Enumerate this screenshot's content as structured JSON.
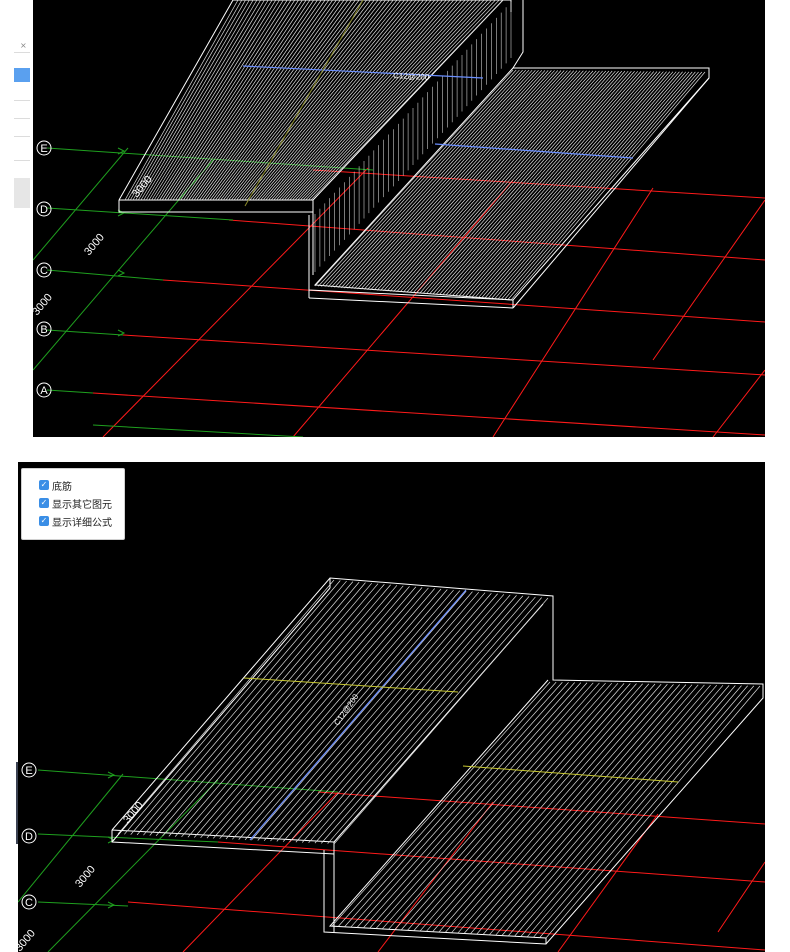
{
  "panel_top": {
    "axes": [
      "E",
      "D",
      "C",
      "B",
      "A"
    ],
    "dimension_labels": [
      "3000",
      "3000",
      "3000"
    ],
    "rebar_label": "C12@200"
  },
  "panel_bottom": {
    "axes": [
      "E",
      "D",
      "C"
    ],
    "dimension_labels": [
      "3000",
      "3000",
      "3000"
    ],
    "rebar_label": "C12@200",
    "options": [
      "底筋",
      "显示其它图元",
      "显示详细公式"
    ],
    "options_checked": [
      true,
      true,
      true
    ]
  },
  "left_strip": {
    "close_glyph": "×"
  },
  "colors": {
    "background": "#000000",
    "grid_red": "#ff1a1a",
    "grid_green": "#1fa01f",
    "rebar_white": "#ffffff",
    "rebar_blue": "#6b8fff",
    "rebar_yellow": "#c8c832",
    "checkbox_blue": "#3a8ee6"
  }
}
